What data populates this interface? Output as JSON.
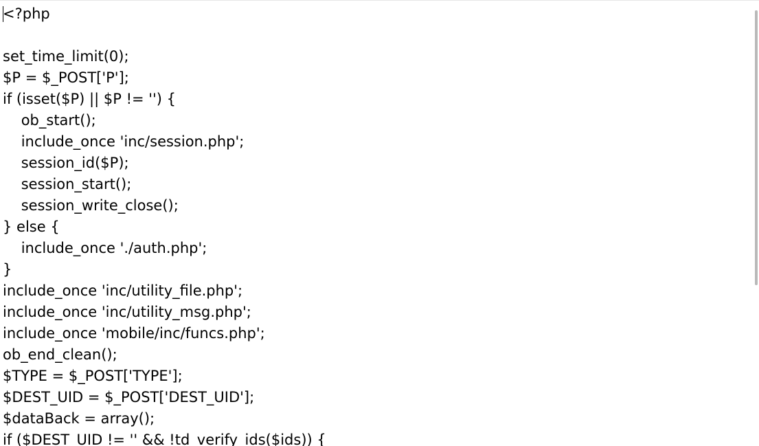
{
  "editor": {
    "lines": [
      "<?php",
      "",
      "set_time_limit(0);",
      "$P = $_POST['P'];",
      "if (isset($P) || $P != '') {",
      "    ob_start();",
      "    include_once 'inc/session.php';",
      "    session_id($P);",
      "    session_start();",
      "    session_write_close();",
      "} else {",
      "    include_once './auth.php';",
      "}",
      "include_once 'inc/utility_file.php';",
      "include_once 'inc/utility_msg.php';",
      "include_once 'mobile/inc/funcs.php';",
      "ob_end_clean();",
      "$TYPE = $_POST['TYPE'];",
      "$DEST_UID = $_POST['DEST_UID'];",
      "$dataBack = array();",
      "if ($DEST_UID != '' && !td_verify_ids($ids)) {"
    ]
  }
}
